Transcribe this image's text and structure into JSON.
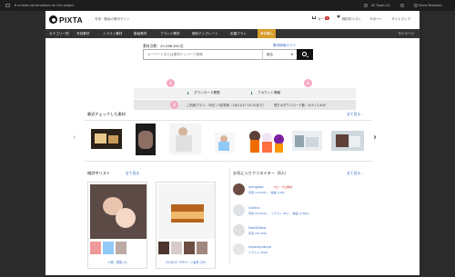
{
  "window": {
    "top_left_text": "6 unread conversations on this project",
    "top_right_types": "All Types (4)",
    "top_right_show": "Show Resolved"
  },
  "header": {
    "logo": "PIXTA",
    "tagline": "写真・動画の素材サイト",
    "cart": "カート",
    "cart_count": "0",
    "favorites": "検討中リスト",
    "support": "サポート",
    "sitemap": "サイトマップ"
  },
  "nav": {
    "items": [
      "カテゴリー別",
      "写真素材",
      "イラスト素材",
      "動画素材",
      "ブランド素材",
      "無料テンプレート",
      "定額プラン",
      "単体購入"
    ],
    "mypage": "マイページ"
  },
  "search": {
    "count_label": "素材点数：20,586,642点",
    "howto": "素材検索のコツ",
    "placeholder": "キーワードまたは素材ナンバーで検索",
    "select_value": "総合"
  },
  "info": {
    "download_history": "ダウンロード履歴",
    "account_info": "アカウント情報",
    "plan_text": "ご利用プラン：30日 / 3名専用（16/11/17 15:10まで）",
    "remaining_text": "残りのダウンロード数：415 / 2,400",
    "pins": [
      "1",
      "2",
      "3"
    ]
  },
  "recent": {
    "title": "最近チェックした素材",
    "see_all": "全て見る ›"
  },
  "lists": {
    "title": "検討中リスト",
    "see_all": "全て見る",
    "cards": [
      {
        "caption": "人物 · 家族 (3)"
      },
      {
        "caption": "2016/12 TOPページ素材 (20)"
      }
    ]
  },
  "creators": {
    "title": "お気に入りクリエイター（6人）",
    "see_all": "全て見る ›",
    "items": [
      {
        "name": "xiangtao",
        "stats": "写真 (13,634) ｜ 動画 (194)",
        "pro": "プロ・プロ素材"
      },
      {
        "name": "Ushico",
        "stats": "写真 (54,620) ｜ イラスト (55) ｜ 動画 (3,590)",
        "pro": ""
      },
      {
        "name": "Fast&Slow",
        "stats": "写真 (50,256)",
        "pro": ""
      },
      {
        "name": "toyotoyotoyo",
        "stats": "イラスト (658)",
        "pro": ""
      }
    ]
  },
  "colors": {
    "nav_bg": "#333333",
    "nav_active": "#d89b2b",
    "link": "#3a6fc6",
    "pin": "#f6a8c4",
    "green_icon": "#2e7d32"
  }
}
